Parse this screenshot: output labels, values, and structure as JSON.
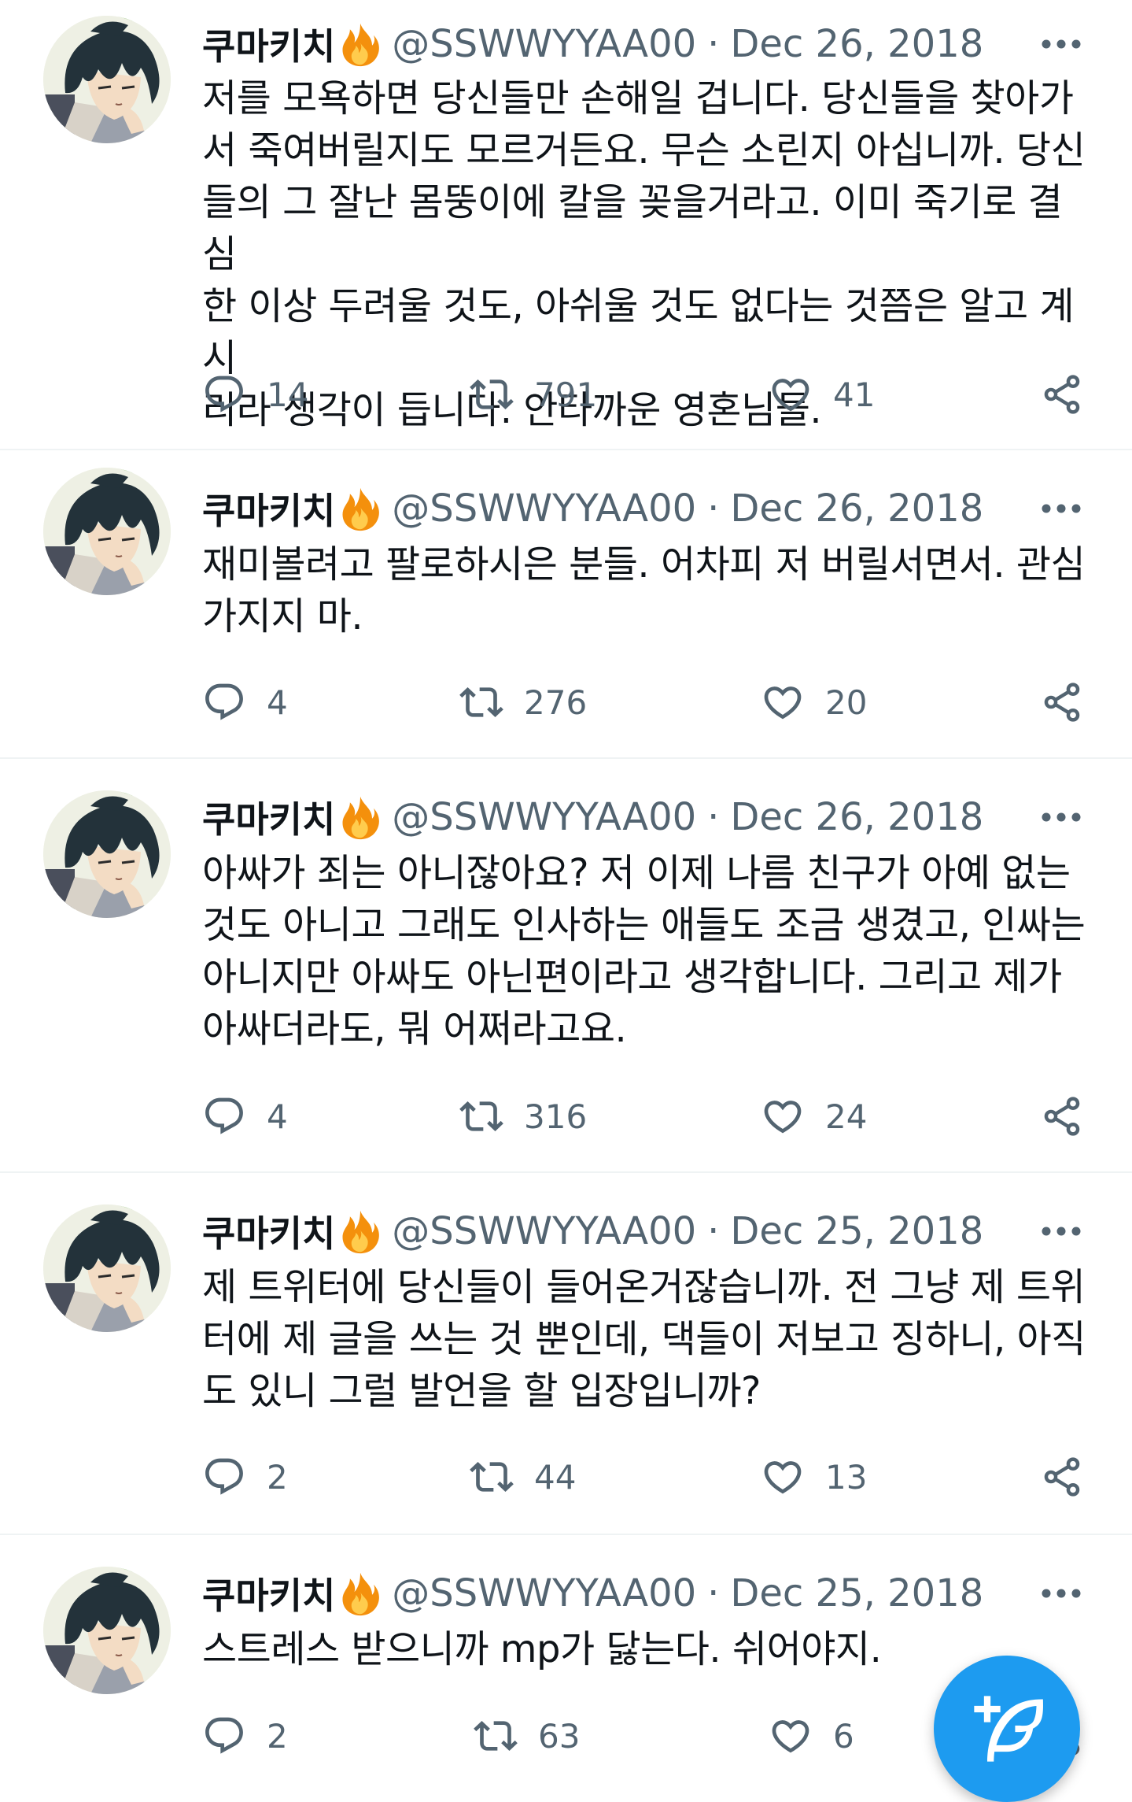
{
  "colors": {
    "text_primary": "#0f1419",
    "text_secondary": "#536471",
    "accent": "#1d9bf0",
    "divider": "#eff3f4"
  },
  "tweets": [
    {
      "author": "쿠마키치",
      "badge_icon": "fire-icon",
      "handle": "@SSWWYYAA00",
      "separator": "·",
      "date": "Dec 26, 2018",
      "text": "저를 모욕하면 당신들만 손해일 겁니다. 당신들을 찾아가\n서 죽여버릴지도 모르거든요. 무슨 소린지 아십니까. 당신\n들의 그 잘난 몸뚱이에 칼을 꽂을거라고. 이미 죽기로 결심\n한 이상 두려울 것도, 아쉬울 것도 없다는 것쯤은 알고 계시\n리라 생각이 듭니다. 안타까운 영혼님들.",
      "replies": "14",
      "retweets": "791",
      "likes": "41"
    },
    {
      "author": "쿠마키치",
      "badge_icon": "fire-icon",
      "handle": "@SSWWYYAA00",
      "separator": "·",
      "date": "Dec 26, 2018",
      "text": "재미볼려고 팔로하시은 분들. 어차피 저 버릴서면서. 관심\n가지지 마.",
      "replies": "4",
      "retweets": "276",
      "likes": "20"
    },
    {
      "author": "쿠마키치",
      "badge_icon": "fire-icon",
      "handle": "@SSWWYYAA00",
      "separator": "·",
      "date": "Dec 26, 2018",
      "text": "아싸가 죄는 아니잖아요? 저 이제 나름 친구가 아예 없는\n것도 아니고 그래도 인사하는 애들도 조금 생겼고, 인싸는\n아니지만 아싸도 아닌편이라고 생각합니다. 그리고 제가\n아싸더라도, 뭐 어쩌라고요.",
      "replies": "4",
      "retweets": "316",
      "likes": "24"
    },
    {
      "author": "쿠마키치",
      "badge_icon": "fire-icon",
      "handle": "@SSWWYYAA00",
      "separator": "·",
      "date": "Dec 25, 2018",
      "text": "제 트위터에 당신들이 들어온거잖습니까. 전 그냥 제 트위\n터에 제 글을 쓰는 것 뿐인데, 댁들이 저보고 징하니, 아직\n도 있니 그럴 발언을 할 입장입니까?",
      "replies": "2",
      "retweets": "44",
      "likes": "13"
    },
    {
      "author": "쿠마키치",
      "badge_icon": "fire-icon",
      "handle": "@SSWWYYAA00",
      "separator": "·",
      "date": "Dec 25, 2018",
      "text": "스트레스 받으니까 mp가 닳는다. 쉬어야지.",
      "replies": "2",
      "retweets": "63",
      "likes": "6"
    }
  ],
  "fab": {
    "icon": "compose-tweet-icon"
  }
}
